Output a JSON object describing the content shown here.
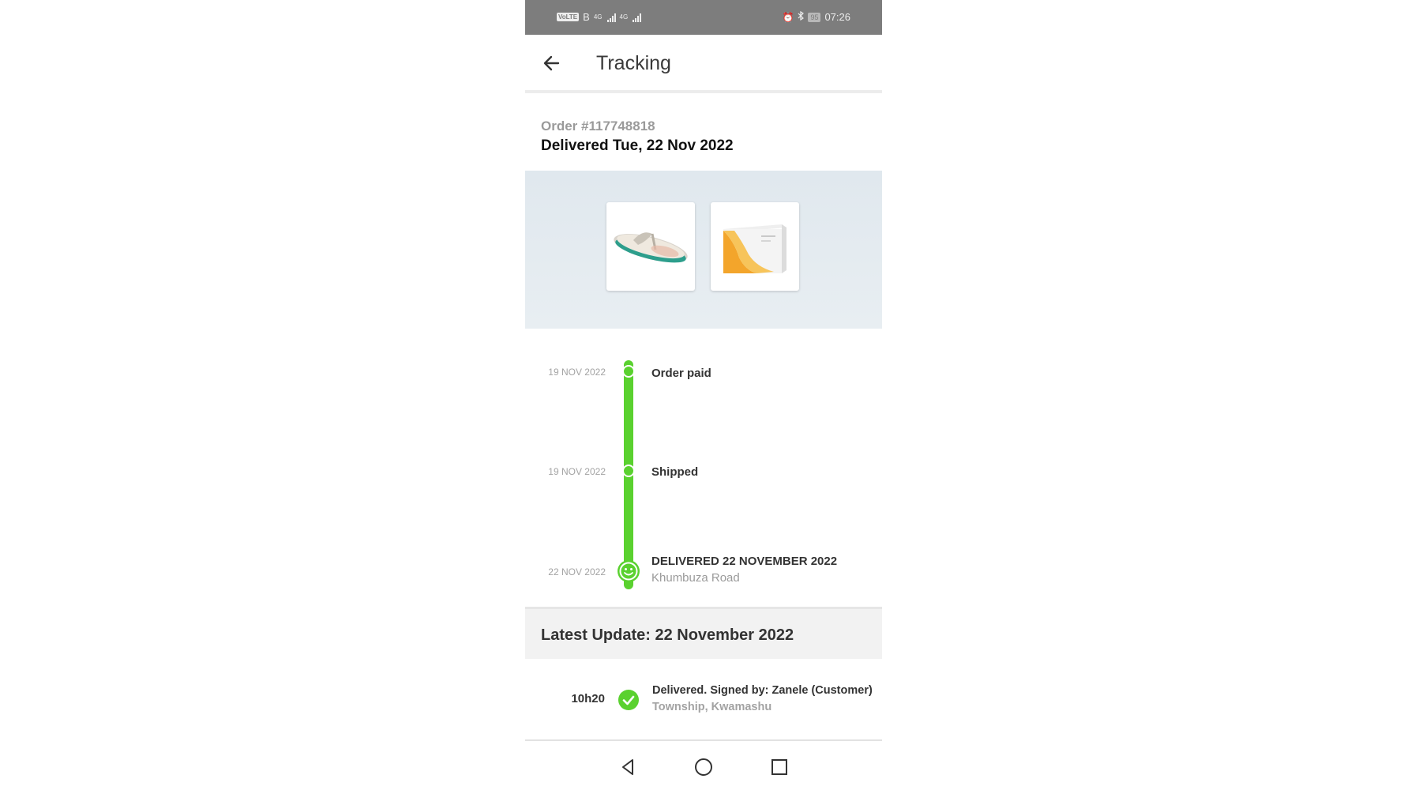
{
  "status_bar": {
    "left_network": "B",
    "signal_1_tag": "4G",
    "signal_2_tag": "4G",
    "volte": "VoLTE",
    "battery": "95",
    "time": "07:26",
    "icons": [
      "alarm-icon",
      "bluetooth-icon",
      "battery-icon"
    ]
  },
  "header": {
    "title": "Tracking",
    "back_icon": "arrow-left-icon"
  },
  "order": {
    "number": "Order #117748818",
    "status": "Delivered Tue, 22 Nov 2022"
  },
  "products": [
    {
      "name": "flip-flop-sandal",
      "image": "sandal"
    },
    {
      "name": "boxed-product",
      "image": "box"
    }
  ],
  "timeline": {
    "accent": "#5ad12f",
    "events": [
      {
        "date": "19 NOV 2022",
        "label": "Order paid",
        "sub": ""
      },
      {
        "date": "19 NOV 2022",
        "label": "Shipped",
        "sub": ""
      },
      {
        "date": "22 NOV 2022",
        "label": "DELIVERED 22 NOVEMBER 2022",
        "sub": "Khumbuza Road"
      }
    ]
  },
  "latest_update": {
    "heading": "Latest Update: 22 November 2022",
    "time": "10h20",
    "title": "Delivered. Signed by: Zanele (Customer)",
    "location": "Township, Kwamashu",
    "status_icon": "check-circle-icon"
  },
  "nav_bar": {
    "buttons": [
      "back-triangle-icon",
      "home-circle-icon",
      "recents-square-icon"
    ]
  }
}
